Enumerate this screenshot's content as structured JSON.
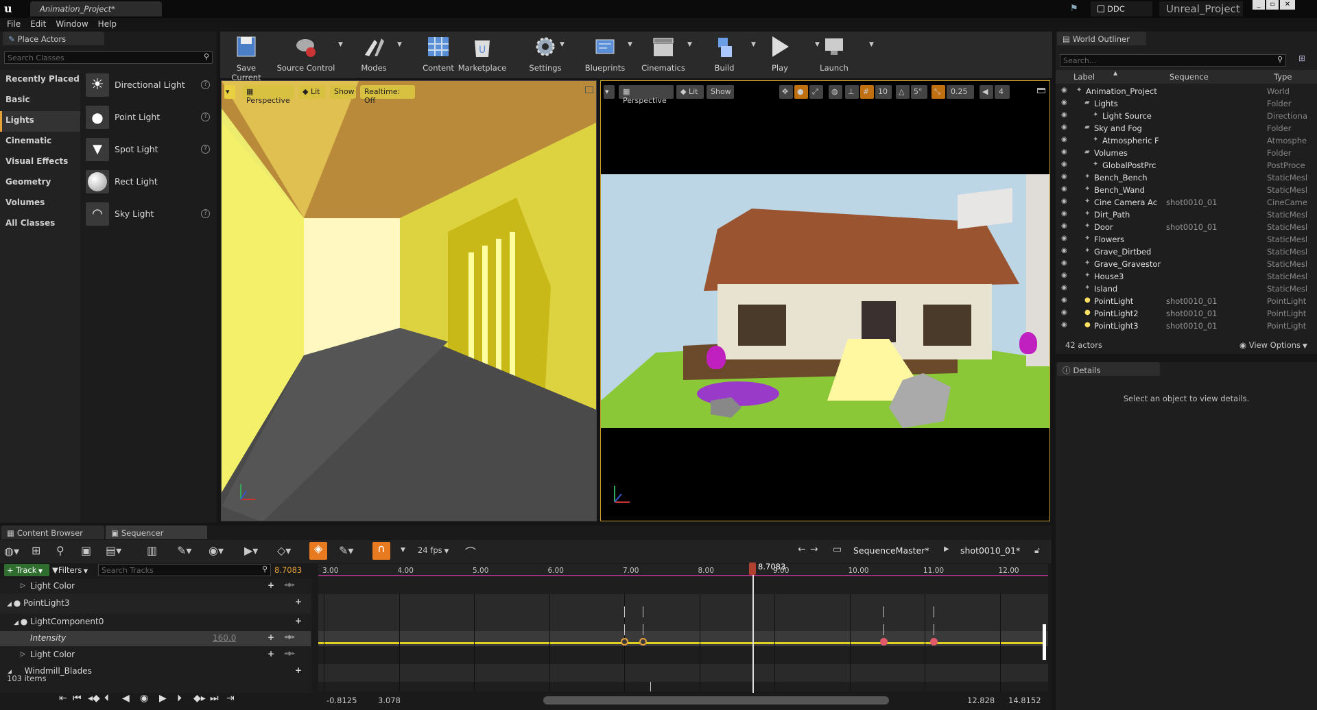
{
  "window": {
    "title_tab": "Animation_Project*",
    "ddc": "DDC",
    "project_name": "Unreal_Project"
  },
  "menu": [
    "File",
    "Edit",
    "Window",
    "Help"
  ],
  "place_actors": {
    "tab": "Place Actors",
    "search_placeholder": "Search Classes",
    "categories": [
      "Recently Placed",
      "Basic",
      "Lights",
      "Cinematic",
      "Visual Effects",
      "Geometry",
      "Volumes",
      "All Classes"
    ],
    "selected_category": "Lights",
    "items": [
      "Directional Light",
      "Point Light",
      "Spot Light",
      "Rect Light",
      "Sky Light"
    ]
  },
  "toolbar": {
    "buttons": [
      "Save Current",
      "Source Control",
      "Modes",
      "Content",
      "Marketplace",
      "Settings",
      "Blueprints",
      "Cinematics",
      "Build",
      "Play",
      "Launch"
    ]
  },
  "viewport_left": {
    "perspective": "Perspective",
    "lit": "Lit",
    "show": "Show",
    "realtime": "Realtime: Off"
  },
  "viewport_right": {
    "perspective": "Perspective",
    "lit": "Lit",
    "show": "Show",
    "grid": "10",
    "angle": "5°",
    "scale": "0.25",
    "cam_speed": "4"
  },
  "outliner": {
    "tab": "World Outliner",
    "search_placeholder": "Search...",
    "columns": [
      "Label",
      "Sequence",
      "Type"
    ],
    "rows": [
      {
        "label": "Animation_Project",
        "sequence": "",
        "type": "World",
        "indent": 0
      },
      {
        "label": "Lights",
        "sequence": "",
        "type": "Folder",
        "indent": 1
      },
      {
        "label": "Light Source",
        "sequence": "",
        "type": "Directiona",
        "indent": 2
      },
      {
        "label": "Sky and Fog",
        "sequence": "",
        "type": "Folder",
        "indent": 1
      },
      {
        "label": "Atmospheric F",
        "sequence": "",
        "type": "Atmosphe",
        "indent": 2
      },
      {
        "label": "Volumes",
        "sequence": "",
        "type": "Folder",
        "indent": 1
      },
      {
        "label": "GlobalPostPrc",
        "sequence": "",
        "type": "PostProce",
        "indent": 2
      },
      {
        "label": "Bench_Bench",
        "sequence": "",
        "type": "StaticMesl",
        "indent": 1
      },
      {
        "label": "Bench_Wand",
        "sequence": "",
        "type": "StaticMesl",
        "indent": 1
      },
      {
        "label": "Cine Camera Ac",
        "sequence": "shot0010_01",
        "type": "CineCame",
        "indent": 1
      },
      {
        "label": "Dirt_Path",
        "sequence": "",
        "type": "StaticMesl",
        "indent": 1
      },
      {
        "label": "Door",
        "sequence": "shot0010_01",
        "type": "StaticMesl",
        "indent": 1
      },
      {
        "label": "Flowers",
        "sequence": "",
        "type": "StaticMesl",
        "indent": 1
      },
      {
        "label": "Grave_Dirtbed",
        "sequence": "",
        "type": "StaticMesl",
        "indent": 1
      },
      {
        "label": "Grave_Gravestor",
        "sequence": "",
        "type": "StaticMesl",
        "indent": 1
      },
      {
        "label": "House3",
        "sequence": "",
        "type": "StaticMesl",
        "indent": 1
      },
      {
        "label": "Island",
        "sequence": "",
        "type": "StaticMesl",
        "indent": 1
      },
      {
        "label": "PointLight",
        "sequence": "shot0010_01",
        "type": "PointLight",
        "indent": 1
      },
      {
        "label": "PointLight2",
        "sequence": "shot0010_01",
        "type": "PointLight",
        "indent": 1
      },
      {
        "label": "PointLight3",
        "sequence": "shot0010_01",
        "type": "PointLight",
        "indent": 1
      }
    ],
    "actor_count": "42 actors",
    "view_options": "View Options"
  },
  "details": {
    "tab": "Details",
    "empty_msg": "Select an object to view details."
  },
  "sequencer": {
    "tabs": [
      "Content Browser",
      "Sequencer"
    ],
    "fps": "24 fps",
    "breadcrumb_root": "SequenceMaster*",
    "breadcrumb_shot": "shot0010_01*",
    "track_button": "Track",
    "filters_button": "Filters",
    "search_placeholder": "Search Tracks",
    "current_time": "8.7083",
    "playhead_label": "8.7083",
    "ruler": [
      "3.00",
      "4.00",
      "5.00",
      "6.00",
      "7.00",
      "8.00",
      "9.00",
      "10.00",
      "11.00",
      "12.00"
    ],
    "tracks": [
      {
        "label": "Light Color",
        "value": ""
      },
      {
        "label": "PointLight3",
        "value": ""
      },
      {
        "label": "LightComponent0",
        "value": ""
      },
      {
        "label": "Intensity",
        "value": "160.0"
      },
      {
        "label": "Light Color",
        "value": ""
      },
      {
        "label": "Windmill_Blades",
        "value": ""
      }
    ],
    "item_count": "103 items",
    "range_start": "-0.8125",
    "view_start": "3.078",
    "view_end": "12.828",
    "range_end": "14.8152"
  }
}
